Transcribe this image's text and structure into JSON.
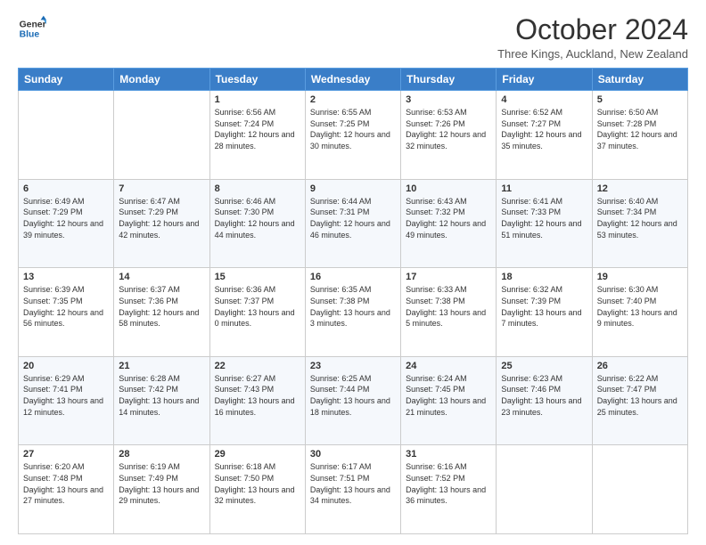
{
  "logo": {
    "line1": "General",
    "line2": "Blue"
  },
  "title": "October 2024",
  "location": "Three Kings, Auckland, New Zealand",
  "days_of_week": [
    "Sunday",
    "Monday",
    "Tuesday",
    "Wednesday",
    "Thursday",
    "Friday",
    "Saturday"
  ],
  "weeks": [
    [
      {
        "day": "",
        "info": ""
      },
      {
        "day": "",
        "info": ""
      },
      {
        "day": "1",
        "info": "Sunrise: 6:56 AM\nSunset: 7:24 PM\nDaylight: 12 hours and 28 minutes."
      },
      {
        "day": "2",
        "info": "Sunrise: 6:55 AM\nSunset: 7:25 PM\nDaylight: 12 hours and 30 minutes."
      },
      {
        "day": "3",
        "info": "Sunrise: 6:53 AM\nSunset: 7:26 PM\nDaylight: 12 hours and 32 minutes."
      },
      {
        "day": "4",
        "info": "Sunrise: 6:52 AM\nSunset: 7:27 PM\nDaylight: 12 hours and 35 minutes."
      },
      {
        "day": "5",
        "info": "Sunrise: 6:50 AM\nSunset: 7:28 PM\nDaylight: 12 hours and 37 minutes."
      }
    ],
    [
      {
        "day": "6",
        "info": "Sunrise: 6:49 AM\nSunset: 7:29 PM\nDaylight: 12 hours and 39 minutes."
      },
      {
        "day": "7",
        "info": "Sunrise: 6:47 AM\nSunset: 7:29 PM\nDaylight: 12 hours and 42 minutes."
      },
      {
        "day": "8",
        "info": "Sunrise: 6:46 AM\nSunset: 7:30 PM\nDaylight: 12 hours and 44 minutes."
      },
      {
        "day": "9",
        "info": "Sunrise: 6:44 AM\nSunset: 7:31 PM\nDaylight: 12 hours and 46 minutes."
      },
      {
        "day": "10",
        "info": "Sunrise: 6:43 AM\nSunset: 7:32 PM\nDaylight: 12 hours and 49 minutes."
      },
      {
        "day": "11",
        "info": "Sunrise: 6:41 AM\nSunset: 7:33 PM\nDaylight: 12 hours and 51 minutes."
      },
      {
        "day": "12",
        "info": "Sunrise: 6:40 AM\nSunset: 7:34 PM\nDaylight: 12 hours and 53 minutes."
      }
    ],
    [
      {
        "day": "13",
        "info": "Sunrise: 6:39 AM\nSunset: 7:35 PM\nDaylight: 12 hours and 56 minutes."
      },
      {
        "day": "14",
        "info": "Sunrise: 6:37 AM\nSunset: 7:36 PM\nDaylight: 12 hours and 58 minutes."
      },
      {
        "day": "15",
        "info": "Sunrise: 6:36 AM\nSunset: 7:37 PM\nDaylight: 13 hours and 0 minutes."
      },
      {
        "day": "16",
        "info": "Sunrise: 6:35 AM\nSunset: 7:38 PM\nDaylight: 13 hours and 3 minutes."
      },
      {
        "day": "17",
        "info": "Sunrise: 6:33 AM\nSunset: 7:38 PM\nDaylight: 13 hours and 5 minutes."
      },
      {
        "day": "18",
        "info": "Sunrise: 6:32 AM\nSunset: 7:39 PM\nDaylight: 13 hours and 7 minutes."
      },
      {
        "day": "19",
        "info": "Sunrise: 6:30 AM\nSunset: 7:40 PM\nDaylight: 13 hours and 9 minutes."
      }
    ],
    [
      {
        "day": "20",
        "info": "Sunrise: 6:29 AM\nSunset: 7:41 PM\nDaylight: 13 hours and 12 minutes."
      },
      {
        "day": "21",
        "info": "Sunrise: 6:28 AM\nSunset: 7:42 PM\nDaylight: 13 hours and 14 minutes."
      },
      {
        "day": "22",
        "info": "Sunrise: 6:27 AM\nSunset: 7:43 PM\nDaylight: 13 hours and 16 minutes."
      },
      {
        "day": "23",
        "info": "Sunrise: 6:25 AM\nSunset: 7:44 PM\nDaylight: 13 hours and 18 minutes."
      },
      {
        "day": "24",
        "info": "Sunrise: 6:24 AM\nSunset: 7:45 PM\nDaylight: 13 hours and 21 minutes."
      },
      {
        "day": "25",
        "info": "Sunrise: 6:23 AM\nSunset: 7:46 PM\nDaylight: 13 hours and 23 minutes."
      },
      {
        "day": "26",
        "info": "Sunrise: 6:22 AM\nSunset: 7:47 PM\nDaylight: 13 hours and 25 minutes."
      }
    ],
    [
      {
        "day": "27",
        "info": "Sunrise: 6:20 AM\nSunset: 7:48 PM\nDaylight: 13 hours and 27 minutes."
      },
      {
        "day": "28",
        "info": "Sunrise: 6:19 AM\nSunset: 7:49 PM\nDaylight: 13 hours and 29 minutes."
      },
      {
        "day": "29",
        "info": "Sunrise: 6:18 AM\nSunset: 7:50 PM\nDaylight: 13 hours and 32 minutes."
      },
      {
        "day": "30",
        "info": "Sunrise: 6:17 AM\nSunset: 7:51 PM\nDaylight: 13 hours and 34 minutes."
      },
      {
        "day": "31",
        "info": "Sunrise: 6:16 AM\nSunset: 7:52 PM\nDaylight: 13 hours and 36 minutes."
      },
      {
        "day": "",
        "info": ""
      },
      {
        "day": "",
        "info": ""
      }
    ]
  ]
}
